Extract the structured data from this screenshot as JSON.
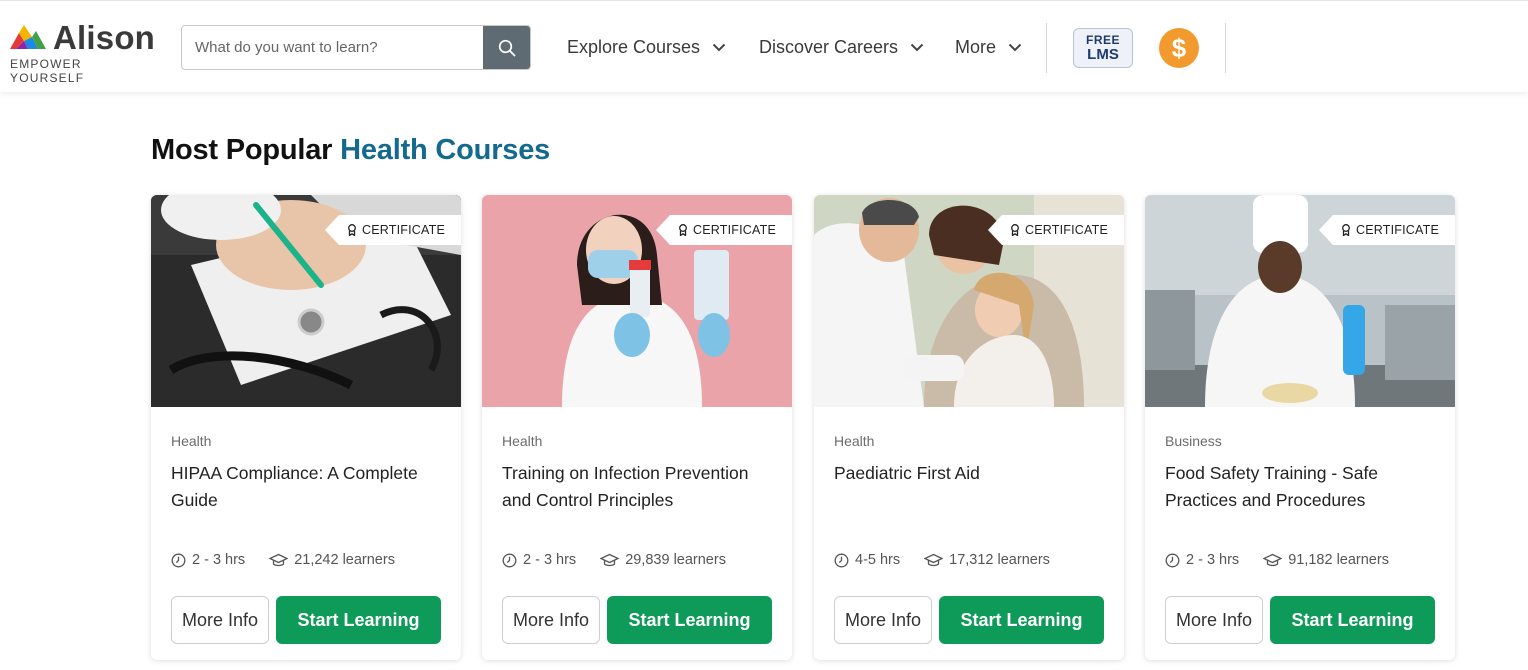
{
  "header": {
    "logo_word": "Alison",
    "logo_tagline": "EMPOWER YOURSELF",
    "search_placeholder": "What do you want to learn?",
    "nav": [
      {
        "label": "Explore Courses"
      },
      {
        "label": "Discover Careers"
      },
      {
        "label": "More"
      }
    ],
    "lms_line1": "FREE",
    "lms_line2": "LMS",
    "coin_symbol": "$"
  },
  "section": {
    "title_prefix": "Most Popular",
    "title_accent": "Health Courses"
  },
  "courses": [
    {
      "certificate": "CERTIFICATE",
      "category": "Health",
      "title": "HIPAA Compliance: A Complete Guide",
      "duration": "2 - 3 hrs",
      "learners": "21,242 learners",
      "more_label": "More Info",
      "start_label": "Start Learning"
    },
    {
      "certificate": "CERTIFICATE",
      "category": "Health",
      "title": "Training on Infection Prevention and Control Principles",
      "duration": "2 - 3 hrs",
      "learners": "29,839 learners",
      "more_label": "More Info",
      "start_label": "Start Learning"
    },
    {
      "certificate": "CERTIFICATE",
      "category": "Health",
      "title": "Paediatric First Aid",
      "duration": "4-5 hrs",
      "learners": "17,312 learners",
      "more_label": "More Info",
      "start_label": "Start Learning"
    },
    {
      "certificate": "CERTIFICATE",
      "category": "Business",
      "title": "Food Safety Training - Safe Practices and Procedures",
      "duration": "2 - 3 hrs",
      "learners": "91,182 learners",
      "more_label": "More Info",
      "start_label": "Start Learning"
    }
  ],
  "colors": {
    "accent_blue": "#146a8e",
    "start_green": "#0e9a58",
    "coin_orange": "#f29a2e",
    "search_button": "#5f6b73"
  },
  "icons": {
    "search": "search-icon",
    "chevron": "chevron-down-icon",
    "certificate": "award-ribbon-icon",
    "clock": "clock-icon",
    "learners": "graduation-cap-icon"
  }
}
